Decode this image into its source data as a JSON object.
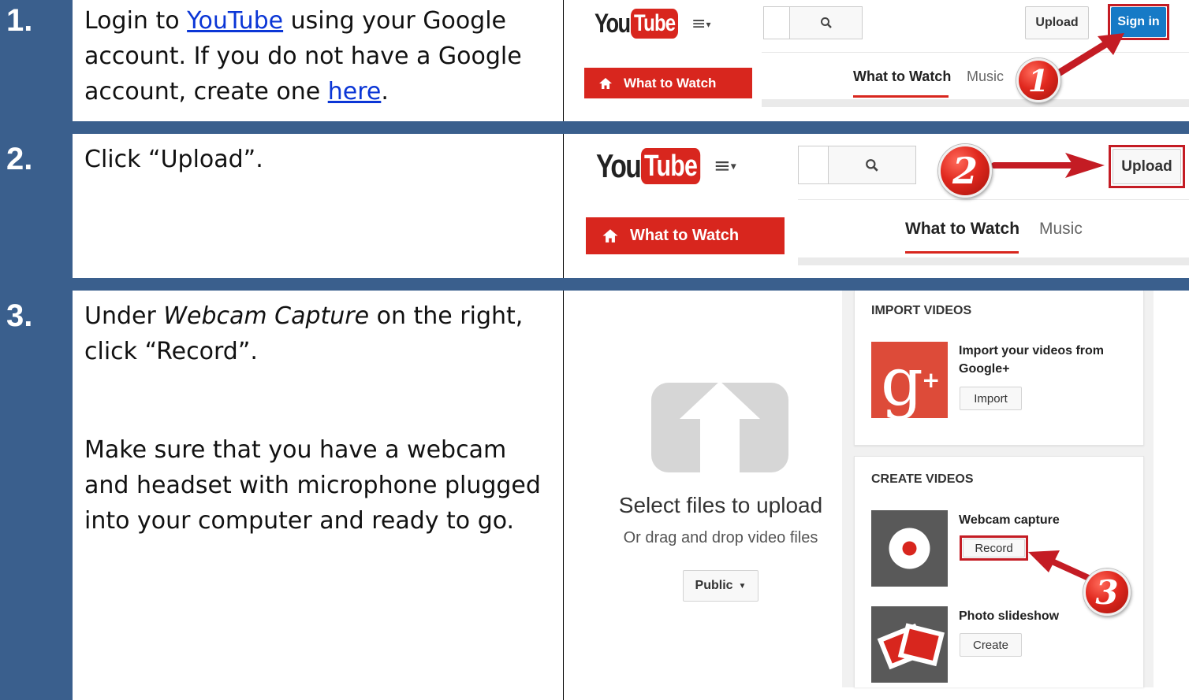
{
  "steps": [
    {
      "number": "1.",
      "text_before": "Login to ",
      "link1": "YouTube",
      "text_mid": " using your Google account.  If you do not have a Google account, create one ",
      "link2": "here",
      "text_after": "."
    },
    {
      "number": "2.",
      "text": "Click “Upload”."
    },
    {
      "number": "3.",
      "text_before": "Under ",
      "italic": "Webcam Capture",
      "text_after": " on the right, click “Record”.",
      "para2": "Make sure that you have a webcam and headset with microphone plugged into your computer and ready to go."
    }
  ],
  "screens": {
    "s1": {
      "logo_you": "You",
      "logo_tube": "Tube",
      "upload": "Upload",
      "sign_in": "Sign in",
      "what_to_watch_btn": "What to Watch",
      "nav_active": "What to Watch",
      "nav_music": "Music",
      "badge": "1"
    },
    "s2": {
      "logo_you": "You",
      "logo_tube": "Tube",
      "upload": "Upload",
      "what_to_watch_btn": "What to Watch",
      "nav_active": "What to Watch",
      "nav_music": "Music",
      "badge": "2"
    },
    "s3": {
      "select_files": "Select files to upload",
      "drag_drop": "Or drag and drop video files",
      "privacy": "Public",
      "import_heading": "IMPORT VIDEOS",
      "import_title": "Import your videos from Google+",
      "import_btn": "Import",
      "create_heading": "CREATE VIDEOS",
      "webcam_title": "Webcam capture",
      "record_btn": "Record",
      "slideshow_title": "Photo slideshow",
      "create_btn": "Create",
      "badge": "3"
    }
  },
  "colors": {
    "sidebar_blue": "#3a5f8d",
    "youtube_red": "#d8261e",
    "annotation_red": "#c41c24",
    "signin_blue": "#167ac6",
    "gplus_red": "#dd4b39"
  }
}
